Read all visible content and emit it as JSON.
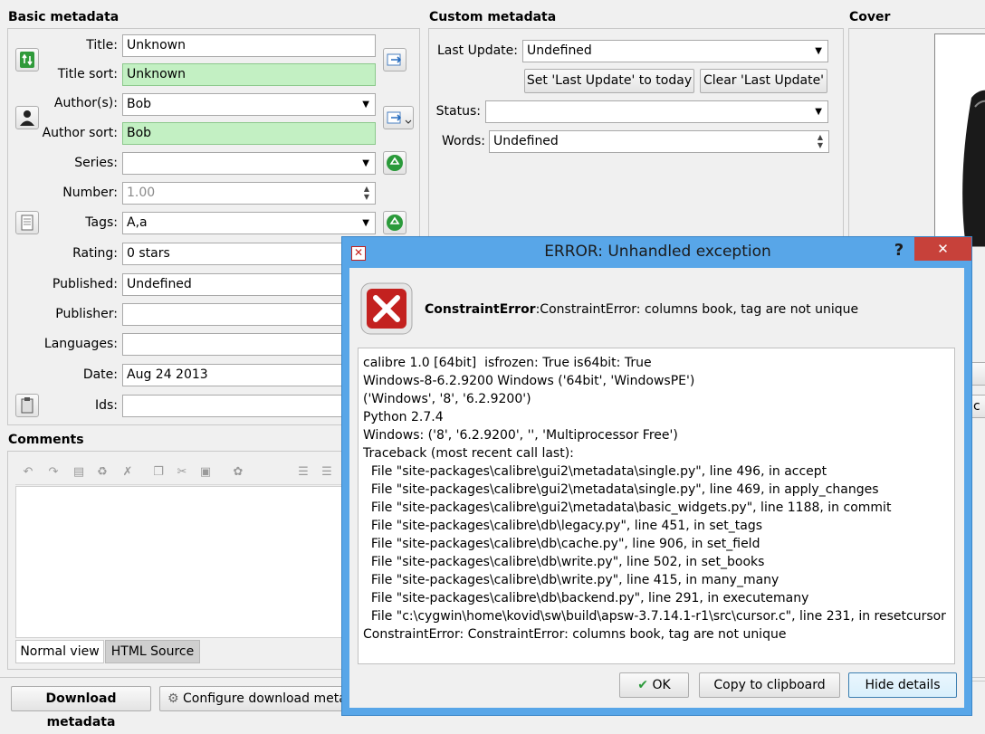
{
  "basic": {
    "title": "Basic metadata",
    "labels": {
      "title": "Title:",
      "title_sort": "Title sort:",
      "authors": "Author(s):",
      "author_sort": "Author sort:",
      "series": "Series:",
      "number": "Number:",
      "tags": "Tags:",
      "rating": "Rating:",
      "published": "Published:",
      "publisher": "Publisher:",
      "languages": "Languages:",
      "date": "Date:",
      "ids": "Ids:"
    },
    "values": {
      "title": "Unknown",
      "title_sort": "Unknown",
      "authors": "Bob",
      "author_sort": "Bob",
      "series": "",
      "number": "1.00",
      "tags": "A,a",
      "rating": "0 stars",
      "published": "Undefined",
      "publisher": "",
      "languages": "",
      "date": "Aug 24 2013",
      "ids": ""
    }
  },
  "comments": {
    "title": "Comments",
    "tab_normal": "Normal view",
    "tab_html": "HTML Source"
  },
  "custom": {
    "title": "Custom metadata",
    "last_update_label": "Last Update:",
    "last_update_value": "Undefined",
    "set_today_button": "Set 'Last Update' to today",
    "clear_button": "Clear 'Last Update'",
    "status_label": "Status:",
    "status_value": "",
    "words_label": "Words:",
    "words_value": "Undefined"
  },
  "cover": {
    "title": "Cover"
  },
  "bottom": {
    "download_button": "Download metadata",
    "configure_button": "Configure download meta"
  },
  "dialog": {
    "title": "ERROR: Unhandled exception",
    "help": "?",
    "close": "✕",
    "message_bold": "ConstraintError",
    "message_rest": ":ConstraintError: columns book, tag are not unique",
    "traceback": [
      "calibre 1.0 [64bit]  isfrozen: True is64bit: True",
      "Windows-8-6.2.9200 Windows ('64bit', 'WindowsPE')",
      "('Windows', '8', '6.2.9200')",
      "Python 2.7.4",
      "Windows: ('8', '6.2.9200', '', 'Multiprocessor Free')",
      "Traceback (most recent call last):",
      "  File \"site-packages\\calibre\\gui2\\metadata\\single.py\", line 496, in accept",
      "  File \"site-packages\\calibre\\gui2\\metadata\\single.py\", line 469, in apply_changes",
      "  File \"site-packages\\calibre\\gui2\\metadata\\basic_widgets.py\", line 1188, in commit",
      "  File \"site-packages\\calibre\\db\\legacy.py\", line 451, in set_tags",
      "  File \"site-packages\\calibre\\db\\cache.py\", line 906, in set_field",
      "  File \"site-packages\\calibre\\db\\write.py\", line 502, in set_books",
      "  File \"site-packages\\calibre\\db\\write.py\", line 415, in many_many",
      "  File \"site-packages\\calibre\\db\\backend.py\", line 291, in executemany",
      "  File \"c:\\cygwin\\home\\kovid\\sw\\build\\apsw-3.7.14.1-r1\\src\\cursor.c\", line 231, in resetcursor",
      "ConstraintError: ConstraintError: columns book, tag are not unique"
    ],
    "ok_button": "OK",
    "copy_button": "Copy to clipboard",
    "hide_button": "Hide details"
  },
  "icons": {
    "ok_check": "check-icon",
    "error_x": "error-x-icon"
  },
  "colors": {
    "green_field": "#c3f0c3",
    "dialog_frame": "#58a6e8",
    "close_red": "#c7413a",
    "error_red": "#c3211f"
  }
}
